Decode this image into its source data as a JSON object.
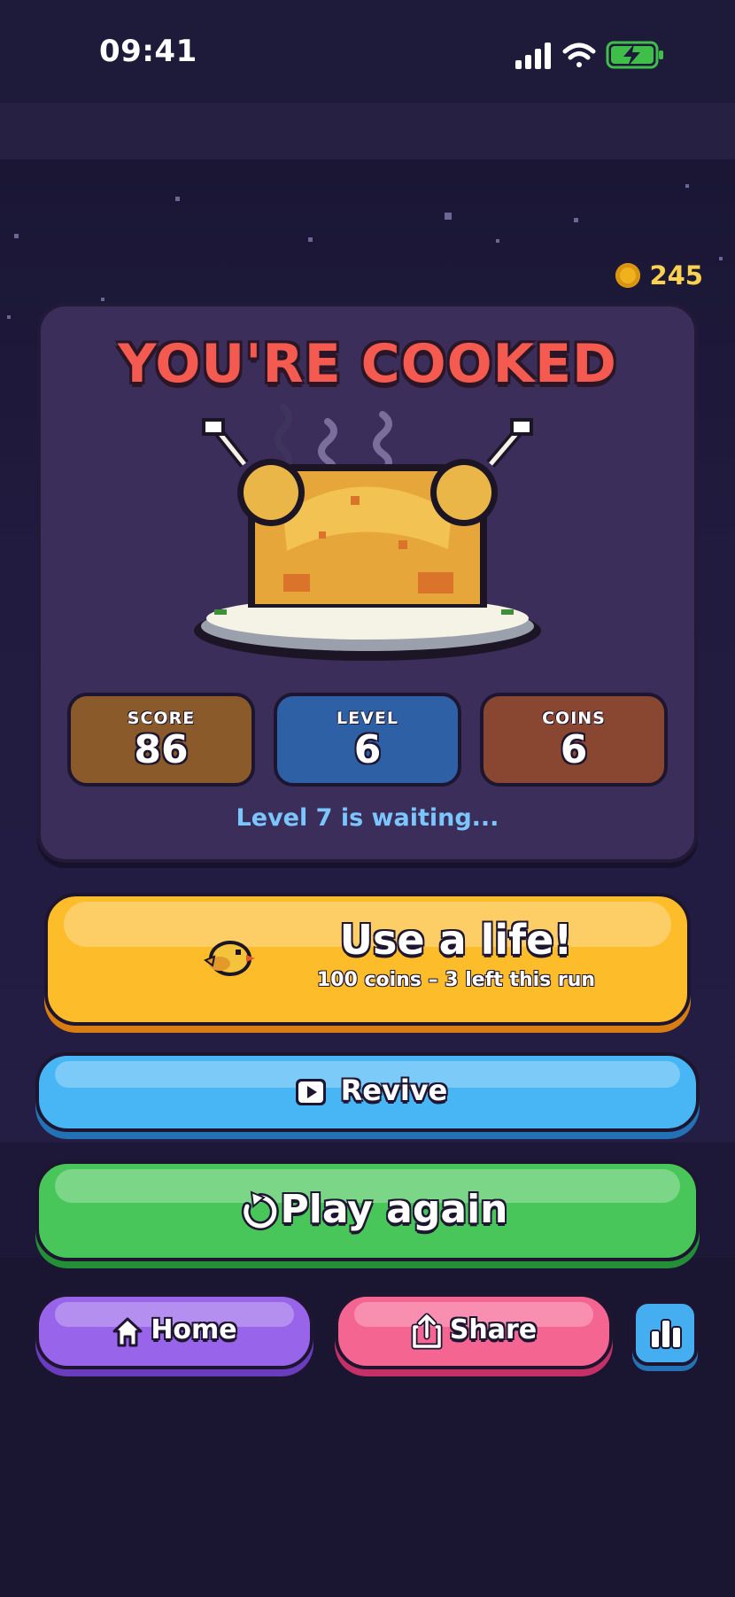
{
  "status_bar": {
    "time": "09:41"
  },
  "coins": {
    "count": "245"
  },
  "result": {
    "title": "YOU'RE COOKED",
    "stats": [
      {
        "label": "SCORE",
        "value": "86",
        "color": "#8a5a2a"
      },
      {
        "label": "LEVEL",
        "value": "6",
        "color": "#2d60a4"
      },
      {
        "label": "COINS",
        "value": "6",
        "color": "#894630"
      }
    ],
    "next_level_message": "Level 7 is waiting..."
  },
  "actions": {
    "use_life": {
      "title": "Use a life!",
      "subtitle": "100 coins – 3 left this run",
      "color": "#fdbc2a"
    },
    "revive": {
      "label": "Revive",
      "icon": "play-video-icon",
      "color": "#48b6f4"
    },
    "play_again": {
      "label": "Play again",
      "icon": "replay-icon",
      "color": "#49c65a"
    },
    "home": {
      "label": "Home",
      "icon": "home-icon",
      "color": "#9865ea"
    },
    "share": {
      "label": "Share",
      "icon": "share-icon",
      "color": "#f56592"
    },
    "leaderboard": {
      "icon": "leaderboard-icon",
      "color": "#44aef0"
    }
  }
}
